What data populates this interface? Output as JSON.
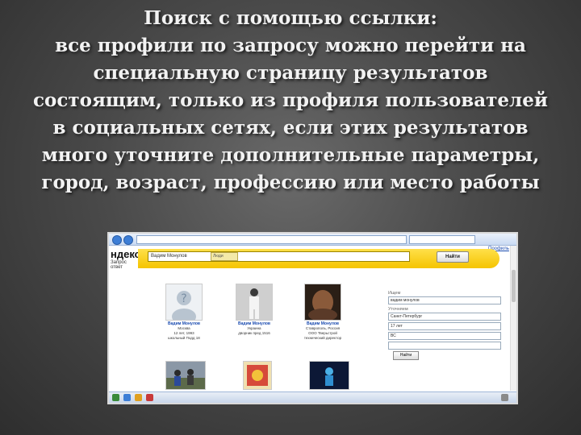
{
  "slide": {
    "lines": [
      "Поиск с помощью ссылки:",
      "все профили по запросу можно перейти на",
      "специальную страницу результатов",
      "состоящим, только из профиля пользователей",
      "в  социальных сетях, если этих результатов",
      "много   уточните дополнительные параметры,",
      "город, возраст, профессию или место работы"
    ]
  },
  "screenshot": {
    "logo": "ндекс",
    "logo_sub": "Запрос ответ",
    "search_value": "Вадим Монулов",
    "search_scope": "Люди",
    "search_button": "Найти",
    "top_link": "Профиль",
    "people": [
      {
        "name": "Вадим Монулов",
        "info1": "Москва",
        "info2": "12 лет, 1993",
        "info3": "школьный Подд 18"
      },
      {
        "name": "Вадим Монулов",
        "info1": "Украина",
        "info2": "дворник пред 1516",
        "info3": ""
      },
      {
        "name": "Вадим Монулов",
        "info1": "Ставрополь, Россия",
        "info2": "ООО Тверьстрой",
        "info3": "технический директор"
      }
    ],
    "side_panel": {
      "label1": "Ищем",
      "field1": "вадим монулов",
      "label2": "Уточняем",
      "field2": "Санкт-Петербург",
      "field3": "17 лет",
      "field4": "ВС",
      "field5": "",
      "button": "Найти"
    }
  }
}
